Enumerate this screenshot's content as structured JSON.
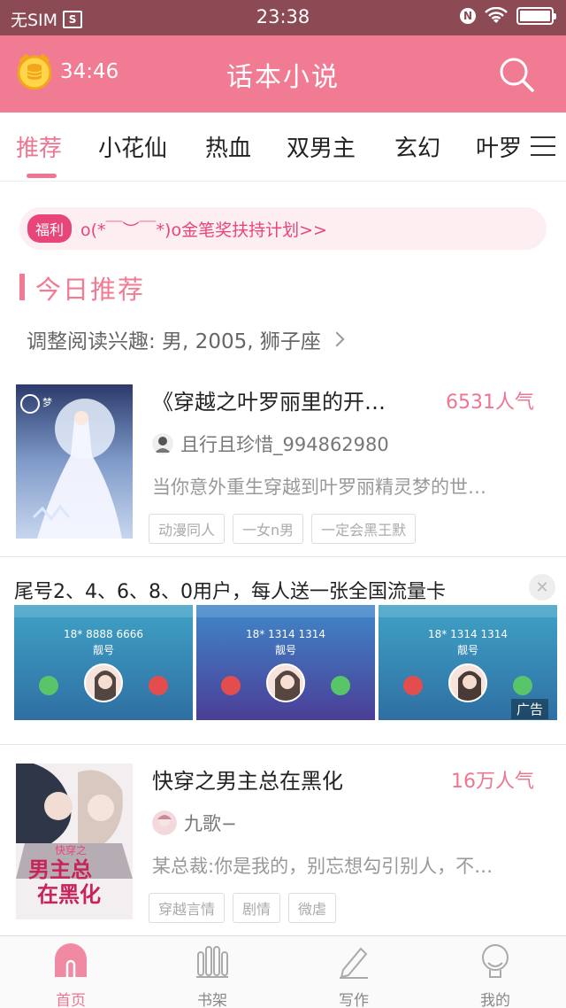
{
  "status_bar": {
    "carrier": "无SIM",
    "time": "23:38",
    "n_badge": "N",
    "icons": [
      "sim-icon",
      "nfc-icon",
      "wifi-icon",
      "battery-icon"
    ]
  },
  "header": {
    "timer": "34:46",
    "title": "话本小说",
    "search_icon": "search-icon",
    "timer_icon": "coin-alarm-icon"
  },
  "tabs": [
    {
      "label": "推荐",
      "active": true
    },
    {
      "label": "小花仙"
    },
    {
      "label": "热血"
    },
    {
      "label": "双男主"
    },
    {
      "label": "玄幻"
    },
    {
      "label": "叶罗"
    }
  ],
  "welfare": {
    "badge": "福利",
    "text": "o(*￣︶￣*)o金笔奖扶持计划>>"
  },
  "section": {
    "title": "今日推荐",
    "interest": "调整阅读兴趣: 男, 2005, 狮子座"
  },
  "books": [
    {
      "title": "《穿越之叶罗丽里的开…",
      "popularity": "6531人气",
      "author": "且行且珍惜_994862980",
      "description": "当你意外重生穿越到叶罗丽精灵梦的世…",
      "tags": [
        "动漫同人",
        "一女n男",
        "一定会黑王默"
      ]
    },
    {
      "title": "快穿之男主总在黑化",
      "popularity": "16万人气",
      "author": "九歌−",
      "description": "某总裁:你是我的，别忘想勾引别人，不…",
      "tags": [
        "穿越言情",
        "剧情",
        "微虐"
      ],
      "cover_text": [
        "快穿之",
        "男主总",
        "在黑化"
      ]
    }
  ],
  "ad": {
    "title": "尾号2、4、6、8、0用户，每人送一张全国流量卡",
    "cards": [
      {
        "number": "18* 8888 6666",
        "label": "靓号"
      },
      {
        "number": "18* 1314 1314",
        "label": "靓号"
      },
      {
        "number": "18* 1314 1314",
        "label": "靓号"
      }
    ],
    "ad_label": "广告"
  },
  "bottom_nav": [
    {
      "label": "首页",
      "icon": "home-icon",
      "active": true
    },
    {
      "label": "书架",
      "icon": "bookshelf-icon"
    },
    {
      "label": "写作",
      "icon": "pen-icon"
    },
    {
      "label": "我的",
      "icon": "profile-icon"
    }
  ],
  "colors": {
    "status_bar": "#8c4a55",
    "header": "#f07b93",
    "accent": "#ee7690",
    "welfare_bg": "#fdeef1",
    "welfare_badge": "#e8467a"
  }
}
